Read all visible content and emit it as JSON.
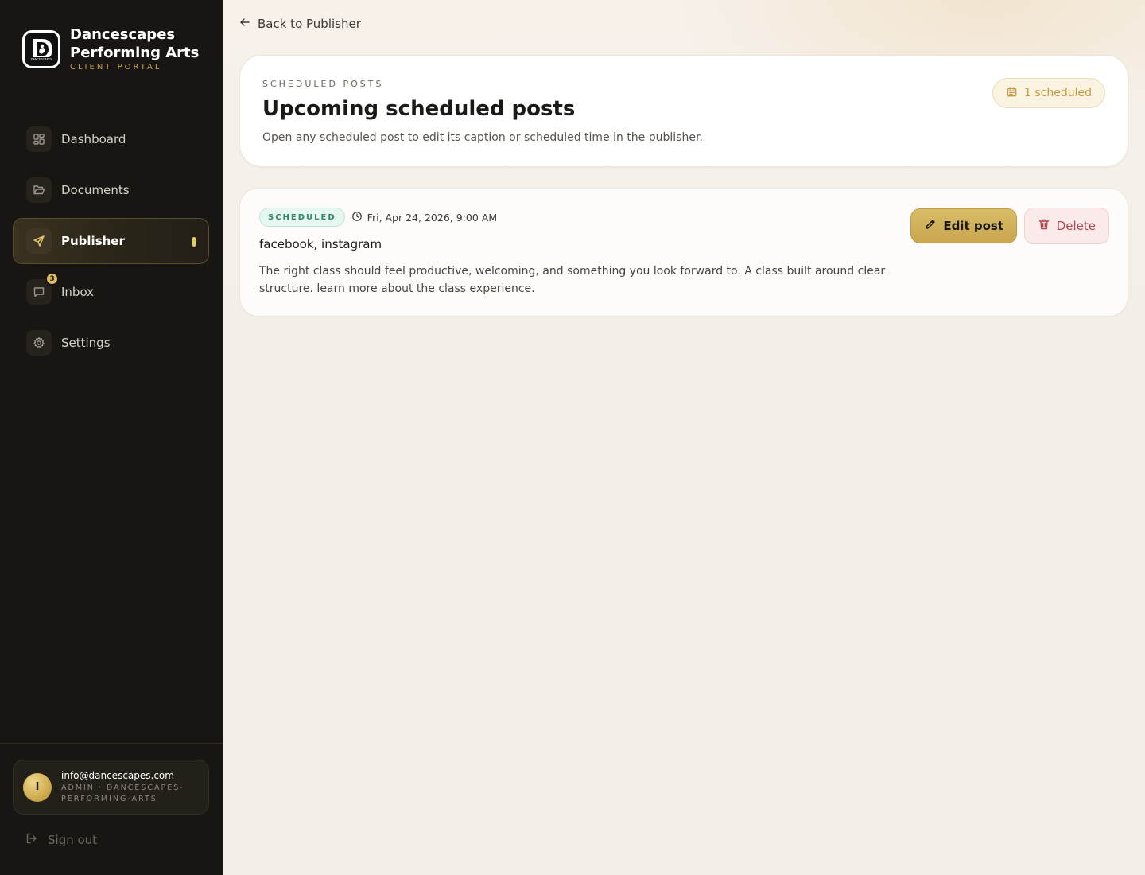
{
  "brand": {
    "name": "Dancescapes Performing Arts",
    "subtitle": "CLIENT PORTAL",
    "logo_text": "DANCESCAPES"
  },
  "nav": {
    "items": [
      {
        "label": "Dashboard",
        "icon": "dashboard-icon"
      },
      {
        "label": "Documents",
        "icon": "folder-icon"
      },
      {
        "label": "Publisher",
        "icon": "send-icon",
        "active": true
      },
      {
        "label": "Inbox",
        "icon": "message-icon",
        "badge": "3"
      },
      {
        "label": "Settings",
        "icon": "gear-icon"
      }
    ]
  },
  "user": {
    "avatar_initial": "I",
    "email": "info@dancescapes.com",
    "role": "ADMIN · DANCESCAPES-PERFORMING-ARTS"
  },
  "signout": {
    "label": "Sign out"
  },
  "back_link": {
    "label": "Back to Publisher"
  },
  "header": {
    "eyebrow": "SCHEDULED POSTS",
    "title": "Upcoming scheduled posts",
    "description": "Open any scheduled post to edit its caption or scheduled time in the publisher.",
    "count_label": "1 scheduled"
  },
  "posts": [
    {
      "status": "SCHEDULED",
      "time": "Fri, Apr 24, 2026, 9:00 AM",
      "platforms": "facebook, instagram",
      "caption": "The right class should feel productive, welcoming, and something you look forward to. A class built around clear structure. learn more about the class experience.",
      "edit_label": "Edit post",
      "delete_label": "Delete"
    }
  ],
  "colors": {
    "sidebar_bg": "#181612",
    "accent_gold": "#c9a54e",
    "status_green": "#2f8a66",
    "danger": "#b5474f"
  }
}
